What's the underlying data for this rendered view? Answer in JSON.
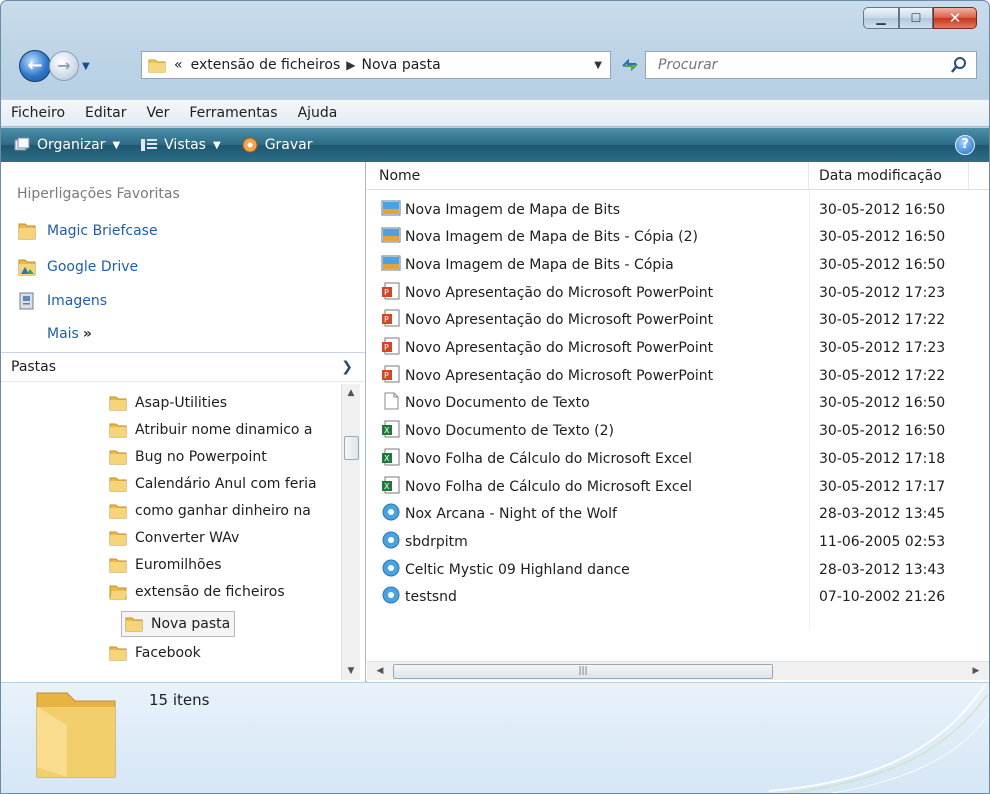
{
  "window": {
    "caption_buttons": [
      "minimize",
      "maximize",
      "close"
    ]
  },
  "address_bar": {
    "recent_glyph": "«",
    "crumbs": [
      "extensão de ficheiros",
      "Nova pasta"
    ],
    "search_placeholder": "Procurar"
  },
  "menu": {
    "items": [
      "Ficheiro",
      "Editar",
      "Ver",
      "Ferramentas",
      "Ajuda"
    ]
  },
  "toolbar": {
    "organize": "Organizar",
    "views": "Vistas",
    "burn": "Gravar",
    "help": "?"
  },
  "favorites": {
    "header": "Hiperligações Favoritas",
    "items": [
      "Magic Briefcase",
      "Google Drive",
      "Imagens"
    ],
    "more": "Mais",
    "more_glyph": "»"
  },
  "folders": {
    "header": "Pastas",
    "items": [
      "Asap-Utilities",
      "Atribuir nome dinamico a",
      "Bug no Powerpoint",
      "Calendário Anul com feria",
      "como ganhar dinheiro na",
      "Converter WAv",
      "Euromilhões",
      "extensão de ficheiros",
      "Nova pasta",
      "Facebook"
    ],
    "selected": "Nova pasta"
  },
  "files": {
    "columns": [
      "Nome",
      "Data modificação"
    ],
    "rows": [
      {
        "name": "Nova Imagem de Mapa de Bits",
        "date": "30-05-2012 16:50",
        "icon": "bitmap-icon"
      },
      {
        "name": "Nova Imagem de Mapa de Bits - Cópia (2)",
        "date": "30-05-2012 16:50",
        "icon": "bitmap-icon"
      },
      {
        "name": "Nova Imagem de Mapa de Bits - Cópia",
        "date": "30-05-2012 16:50",
        "icon": "bitmap-icon"
      },
      {
        "name": "Novo Apresentação do Microsoft PowerPoint",
        "date": "30-05-2012 17:23",
        "icon": "powerpoint-icon"
      },
      {
        "name": "Novo Apresentação do Microsoft PowerPoint",
        "date": "30-05-2012 17:22",
        "icon": "powerpoint-icon"
      },
      {
        "name": "Novo Apresentação do Microsoft PowerPoint",
        "date": "30-05-2012 17:23",
        "icon": "powerpoint-icon"
      },
      {
        "name": "Novo Apresentação do Microsoft PowerPoint",
        "date": "30-05-2012 17:22",
        "icon": "powerpoint-icon"
      },
      {
        "name": "Novo Documento de Texto",
        "date": "30-05-2012 16:50",
        "icon": "text-doc-icon"
      },
      {
        "name": "Novo Documento de Texto (2)",
        "date": "30-05-2012 16:50",
        "icon": "excel-icon"
      },
      {
        "name": "Novo Folha de Cálculo do Microsoft Excel",
        "date": "30-05-2012 17:18",
        "icon": "excel-icon"
      },
      {
        "name": "Novo Folha de Cálculo do Microsoft Excel",
        "date": "30-05-2012 17:17",
        "icon": "excel-icon"
      },
      {
        "name": "Nox Arcana - Night of the Wolf",
        "date": "28-03-2012 13:45",
        "icon": "audio-icon"
      },
      {
        "name": "sbdrpitm",
        "date": "11-06-2005 02:53",
        "icon": "audio-icon"
      },
      {
        "name": "Celtic Mystic 09 Highland dance",
        "date": "28-03-2012 13:43",
        "icon": "audio-icon"
      },
      {
        "name": "testsnd",
        "date": "07-10-2002 21:26",
        "icon": "audio-icon"
      }
    ]
  },
  "details": {
    "item_count": "15 itens"
  },
  "colors": {
    "link_blue": "#1f5fa7",
    "command_bar": "#2c6a84",
    "frame": "#bcd3e6"
  }
}
